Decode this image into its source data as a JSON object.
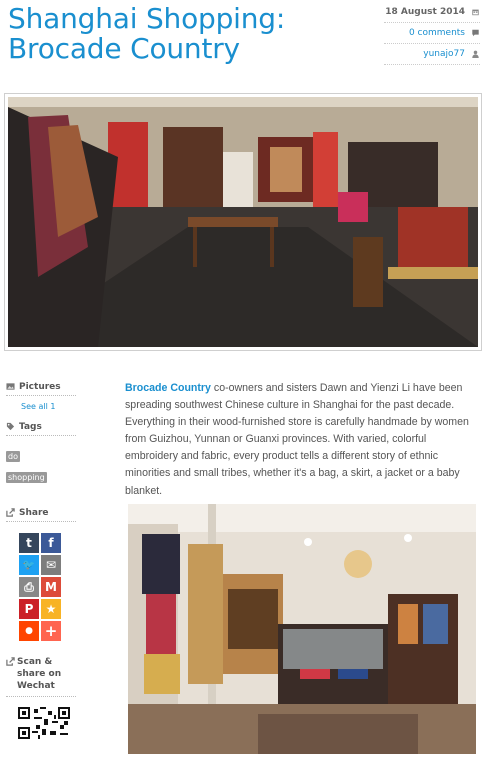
{
  "article": {
    "title": "Shanghai Shopping: Brocade Country",
    "date": "18 August 2014",
    "comments": "0 comments",
    "author": "yunajo77",
    "lead_link": "Brocade Country",
    "body": " co-owners and sisters Dawn and Yienzi Li have been spreading southwest Chinese culture in Shanghai for the past decade. Everything in their wood-furnished store is carefully handmade by women from Guizhou, Yunnan or Guanxi provinces. With varied, colorful embroidery and fabric, every product tells a different story of ethnic minorities and small tribes, whether it's a bag, a skirt, a jacket or a baby blanket."
  },
  "sidebar": {
    "pictures_label": "Pictures",
    "see_all_label": "See all 1",
    "tags_label": "Tags",
    "tags": [
      "do",
      "shopping"
    ],
    "share_label": "Share",
    "share_buttons": [
      {
        "name": "tumblr",
        "glyph": "t",
        "color": "#35465c"
      },
      {
        "name": "facebook",
        "glyph": "f",
        "color": "#3b5998"
      },
      {
        "name": "twitter",
        "glyph": "🐦",
        "color": "#1da1f2"
      },
      {
        "name": "email",
        "glyph": "✉",
        "color": "#7d7d7d"
      },
      {
        "name": "print",
        "glyph": "⎙",
        "color": "#888888"
      },
      {
        "name": "gmail",
        "glyph": "M",
        "color": "#dd4b39"
      },
      {
        "name": "pinterest",
        "glyph": "P",
        "color": "#cb2027"
      },
      {
        "name": "favorites",
        "glyph": "★",
        "color": "#f8b324"
      },
      {
        "name": "reddit",
        "glyph": "●",
        "color": "#ff4500"
      },
      {
        "name": "more",
        "glyph": "+",
        "color": "#ff6550"
      }
    ],
    "wechat_label": "Scan & share on Wechat"
  },
  "colors": {
    "accent": "#1a8fcf"
  }
}
